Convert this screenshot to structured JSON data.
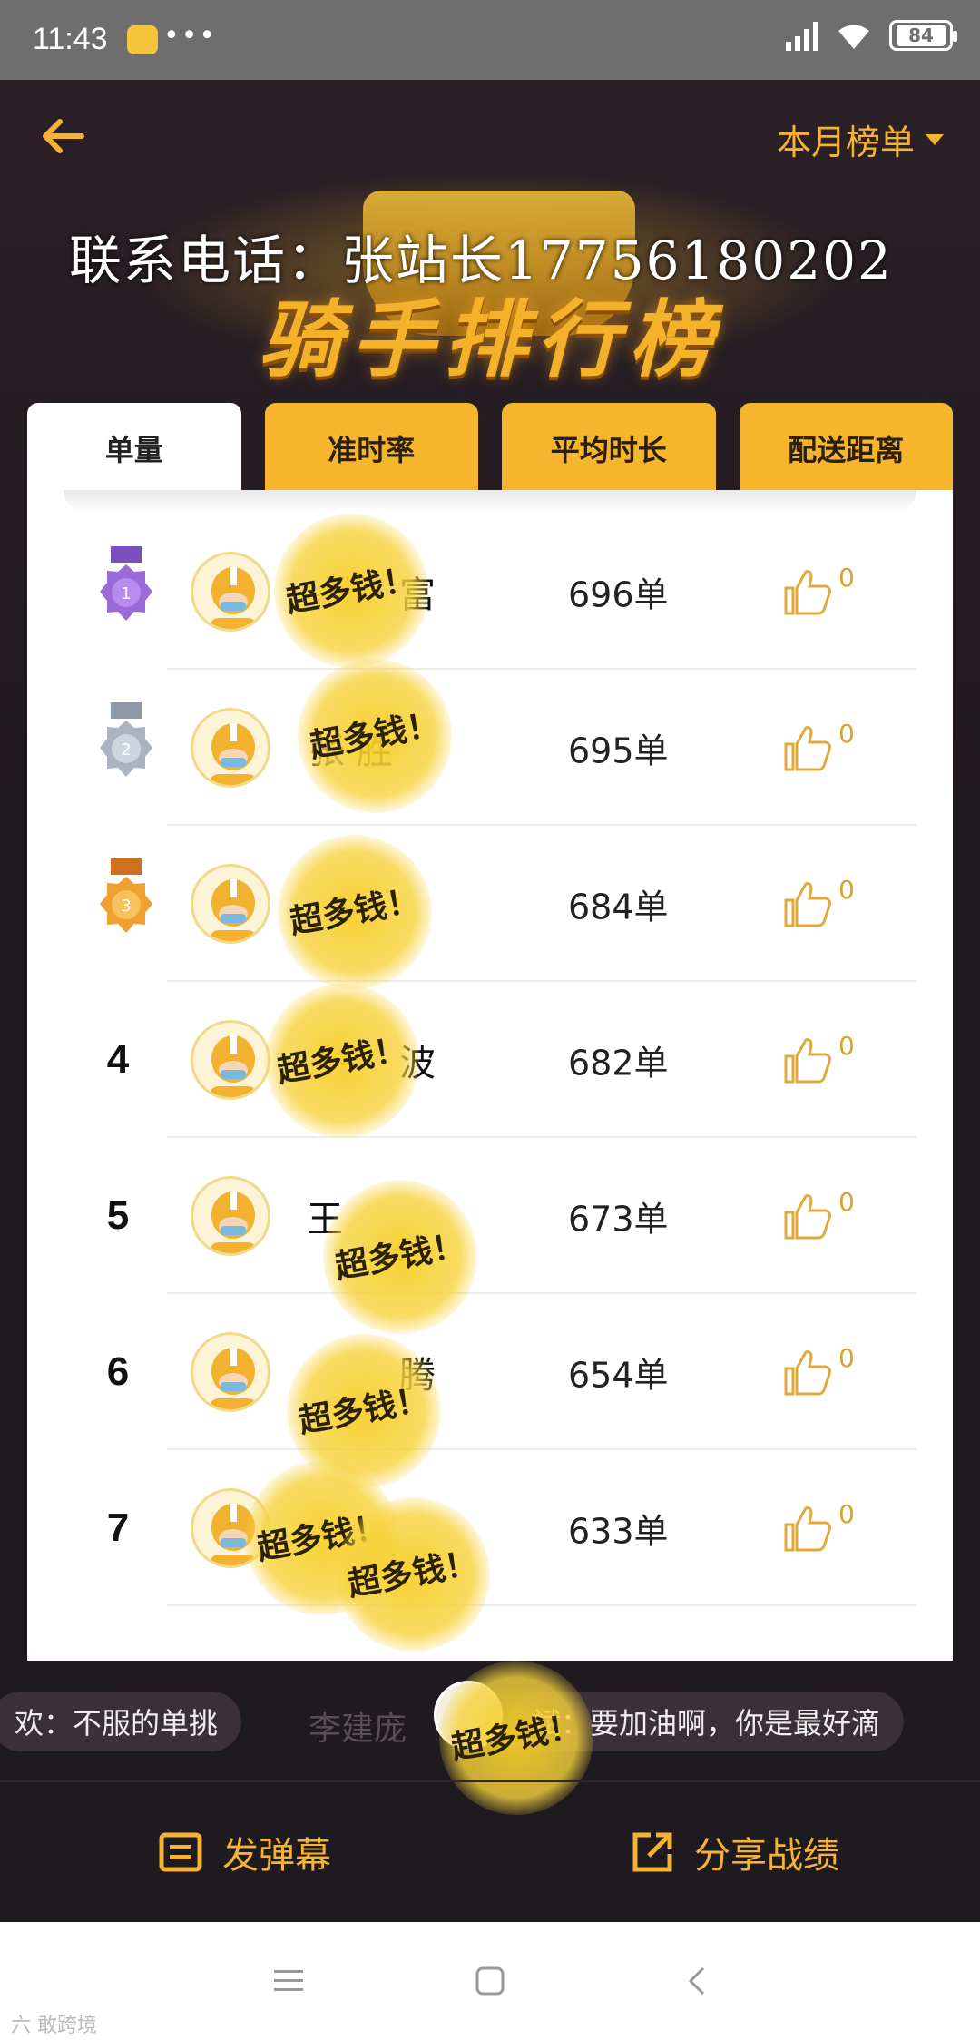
{
  "status_bar": {
    "time": "11:43",
    "dots": "•••",
    "battery": "84"
  },
  "header": {
    "month_filter": "本月榜单"
  },
  "banner": {
    "title": "骑手排行榜",
    "contact_text": "联系电话：张站长17756180202"
  },
  "tabs": [
    {
      "label": "单量",
      "active": true
    },
    {
      "label": "准时率",
      "active": false
    },
    {
      "label": "平均时长",
      "active": false
    },
    {
      "label": "配送距离",
      "active": false
    }
  ],
  "blur_text": "超多钱！",
  "riders": [
    {
      "rank": "1",
      "medal": "purple",
      "name": "富",
      "orders": "696单",
      "likes": "0"
    },
    {
      "rank": "2",
      "medal": "silver",
      "name": "张 胜",
      "orders": "695单",
      "likes": "0"
    },
    {
      "rank": "3",
      "medal": "bronze",
      "name": "",
      "orders": "684单",
      "likes": "0"
    },
    {
      "rank": "4",
      "medal": "",
      "name": "波",
      "orders": "682单",
      "likes": "0"
    },
    {
      "rank": "5",
      "medal": "",
      "name": "王",
      "orders": "673单",
      "likes": "0"
    },
    {
      "rank": "6",
      "medal": "",
      "name": "腾",
      "orders": "654单",
      "likes": "0"
    },
    {
      "rank": "7",
      "medal": "",
      "name": "",
      "orders": "633单",
      "likes": "0"
    }
  ],
  "danmu": {
    "left_message": "欢：不服的单挑",
    "ghost_name": "李建庞",
    "right_message": "斌：要加油啊，你是最好滴"
  },
  "actions": {
    "send_danmu": "发弹幕",
    "share": "分享战绩"
  },
  "watermark": "六 敢跨境",
  "colors": {
    "accent": "#f6b233",
    "tab_yellow": "#f7b52d",
    "dark_bg": "#1f1a20"
  }
}
